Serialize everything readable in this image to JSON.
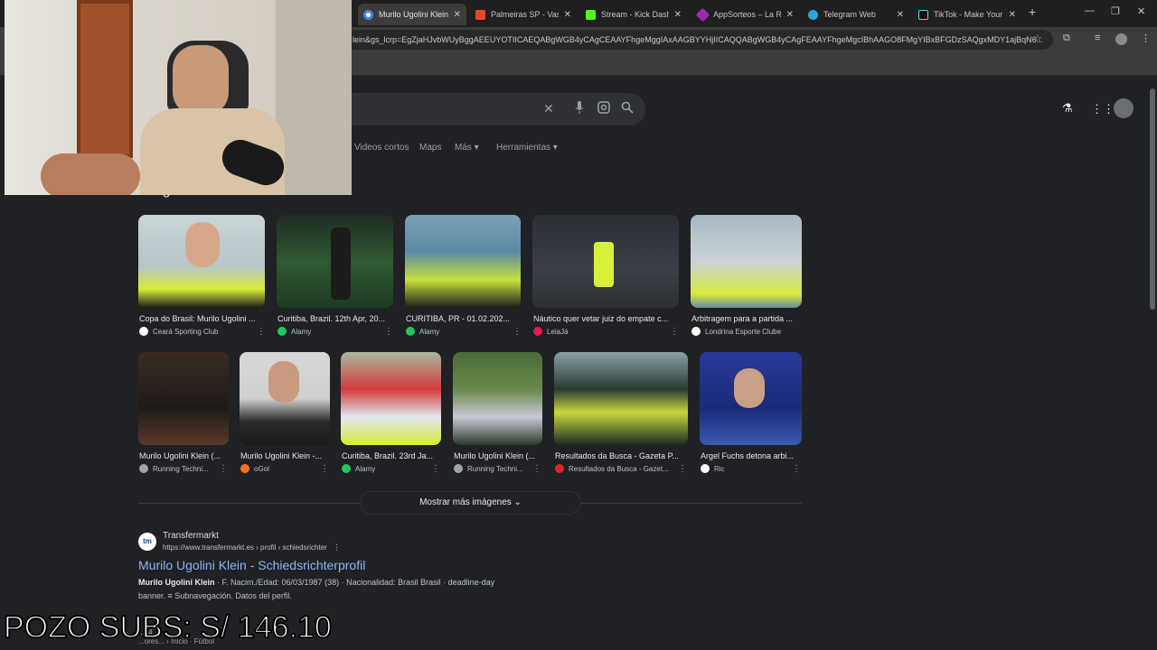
{
  "browser": {
    "tabs": [
      {
        "title": "Murilo Ugolini Klein",
        "color": "#4285f4"
      },
      {
        "title": "Palmeiras SP - Vasco",
        "color": "#e8452c"
      },
      {
        "title": "Stream - Kick Dashbo",
        "color": "#53fc18"
      },
      {
        "title": "AppSorteos – La Rule",
        "color": "#9c27b0"
      },
      {
        "title": "Telegram Web",
        "color": "#2aa3e0"
      },
      {
        "title": "TikTok - Make Your D",
        "color": "#111111"
      }
    ],
    "new_tab": "+",
    "window_controls": [
      "—",
      "❐",
      "✕"
    ],
    "url": "lein&gs_lcrp=EgZjaHJvbWUyBggAEEUYOTIICAEQABgWGB4yCAgCEAAYFhgeMggIAxAAGBYYHjIICAQQABgWGB4yCAgFEAAYFhgeMgcIBhAAGO8FMgYIBxBFGDzSAQgxMDY1ajBqN6..."
  },
  "search": {
    "nav_tabs": [
      "Videos cortos",
      "Maps",
      "Más ▾",
      "Herramientas ▾"
    ],
    "section_title": "Imágenes",
    "images_row1": [
      {
        "caption": "Copa do Brasil: Murilo Ugolini ...",
        "source": "Ceará Sporting Club",
        "src_color": "#ffffff"
      },
      {
        "caption": "Curitiba, Brazil. 12th Apr, 20...",
        "source": "Alamy",
        "src_color": "#22c55e"
      },
      {
        "caption": "CURITIBA, PR - 01.02.202...",
        "source": "Alamy",
        "src_color": "#22c55e"
      },
      {
        "caption": "Náutico quer vetar juiz do empate c...",
        "source": "LeiaJá",
        "src_color": "#e11d48"
      },
      {
        "caption": "Arbitragem para a partida ...",
        "source": "Londrina Esporte Clube",
        "src_color": "#ffffff"
      }
    ],
    "images_row2": [
      {
        "caption": "Murilo Ugolini Klein (...",
        "source": "Running Techni...",
        "src_color": "#9ca3af"
      },
      {
        "caption": "Murilo Ugolini Klein -...",
        "source": "oGol",
        "src_color": "#f97316"
      },
      {
        "caption": "Curitiba, Brazil. 23rd Ja...",
        "source": "Alamy",
        "src_color": "#22c55e"
      },
      {
        "caption": "Murilo Ugolini Klein (...",
        "source": "Running Techni...",
        "src_color": "#9ca3af"
      },
      {
        "caption": "Resultados da Busca - Gazeta P...",
        "source": "Resultados da Busca - Gazet...",
        "src_color": "#dc2626"
      },
      {
        "caption": "Argel Fuchs detona arbi...",
        "source": "Ric",
        "src_color": "#ffffff"
      }
    ],
    "more_images": "Mostrar más imágenes",
    "result": {
      "logo_text": "tm",
      "site": "Transfermarkt",
      "url": "https://www.transfermarkt.es › profil › schiedsrichter",
      "title": "Murilo Ugolini Klein - Schiedsrichterprofil",
      "snippet_bold": "Murilo Ugolini Klein",
      "snippet_rest": " · F. Nacim./Edad: 06/03/1987 (38) · Nacionalidad: Brasil Brasil · deadline-day",
      "snippet_line2": "banner. ≡ Subnavegación. Datos del perfil.",
      "next_line1": "...24",
      "next_line2": "...ores... › Inicio · Fútbol"
    }
  },
  "overlay": {
    "pozo_text": "POZO SUBS: S/ 146.10"
  }
}
